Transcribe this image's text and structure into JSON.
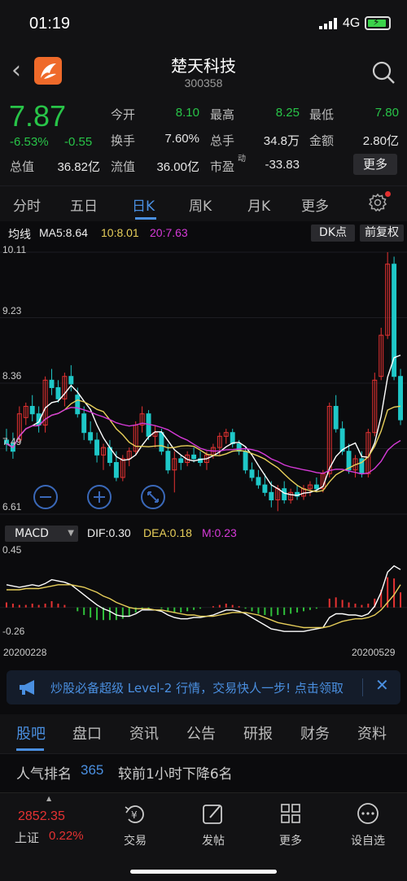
{
  "status_bar": {
    "time": "01:19",
    "network": "4G",
    "battery_level": 0.7
  },
  "header": {
    "title": "楚天科技",
    "code": "300358"
  },
  "quote": {
    "price": "7.87",
    "change_pct": "-6.53%",
    "change": "-0.55",
    "fields": [
      {
        "label": "今开",
        "value": "8.10",
        "color": "#28c448"
      },
      {
        "label": "最高",
        "value": "8.25",
        "color": "#28c448"
      },
      {
        "label": "最低",
        "value": "7.80",
        "color": "#28c448"
      },
      {
        "label": "换手",
        "value": "7.60%",
        "color": "#e6e6e6"
      },
      {
        "label": "总手",
        "value": "34.8万",
        "color": "#e6e6e6"
      },
      {
        "label": "金额",
        "value": "2.80亿",
        "color": "#e6e6e6"
      },
      {
        "label": "总值",
        "value": "36.82亿",
        "color": "#e6e6e6"
      },
      {
        "label": "流值",
        "value": "36.00亿",
        "color": "#e6e6e6"
      },
      {
        "label": "市盈",
        "label_sup": "动",
        "value": "-33.83",
        "color": "#e6e6e6"
      }
    ],
    "more_label": "更多"
  },
  "period_tabs": [
    "分时",
    "五日",
    "日K",
    "周K",
    "月K",
    "更多"
  ],
  "period_active": 2,
  "ma_bar": {
    "label": "均线",
    "ma5": "MA5:8.64",
    "ma10": "10:8.01",
    "ma20": "20:7.63",
    "dk_label": "DK点",
    "adjust_label": "前复权"
  },
  "kline": {
    "y_labels": [
      "10.11",
      "9.23",
      "8.36",
      "7.49",
      "6.61"
    ],
    "y_max": 10.11,
    "y_min": 6.61,
    "colors": {
      "up": "#e63232",
      "down": "#1fc8c8",
      "ma5": "#ffffff",
      "ma10": "#e8cf5a",
      "ma20": "#d63ad8"
    },
    "candles": [
      [
        7.6,
        7.75,
        7.45,
        7.55
      ],
      [
        7.55,
        7.7,
        7.35,
        7.45
      ],
      [
        7.6,
        8.05,
        7.55,
        7.95
      ],
      [
        7.9,
        8.1,
        7.8,
        8.05
      ],
      [
        8.05,
        8.2,
        7.85,
        7.95
      ],
      [
        7.95,
        8.05,
        7.7,
        7.8
      ],
      [
        7.8,
        8.45,
        7.7,
        8.4
      ],
      [
        8.4,
        8.55,
        8.2,
        8.3
      ],
      [
        8.3,
        8.4,
        8.1,
        8.15
      ],
      [
        8.15,
        8.5,
        8.05,
        8.45
      ],
      [
        8.45,
        8.6,
        8.25,
        8.35
      ],
      [
        8.2,
        8.3,
        7.9,
        7.95
      ],
      [
        7.95,
        8.05,
        7.6,
        7.7
      ],
      [
        7.7,
        7.85,
        7.55,
        7.6
      ],
      [
        7.6,
        7.7,
        7.3,
        7.4
      ],
      [
        7.4,
        7.55,
        7.2,
        7.5
      ],
      [
        7.5,
        7.6,
        7.25,
        7.3
      ],
      [
        7.3,
        7.45,
        7.05,
        7.1
      ],
      [
        7.1,
        7.4,
        7.05,
        7.35
      ],
      [
        7.35,
        7.5,
        7.25,
        7.45
      ],
      [
        7.45,
        7.85,
        7.4,
        7.8
      ],
      [
        7.8,
        8.05,
        7.7,
        7.95
      ],
      [
        7.95,
        8.0,
        7.6,
        7.65
      ],
      [
        7.65,
        7.8,
        7.5,
        7.7
      ],
      [
        7.7,
        7.75,
        7.4,
        7.45
      ],
      [
        7.45,
        7.55,
        7.15,
        7.2
      ],
      [
        7.2,
        7.45,
        6.9,
        7.35
      ],
      [
        7.35,
        7.4,
        7.2,
        7.3
      ],
      [
        7.3,
        7.45,
        7.25,
        7.4
      ],
      [
        7.4,
        7.5,
        7.3,
        7.35
      ],
      [
        7.35,
        7.45,
        7.25,
        7.3
      ],
      [
        7.3,
        7.45,
        7.2,
        7.4
      ],
      [
        7.4,
        7.55,
        7.35,
        7.5
      ],
      [
        7.5,
        7.7,
        7.4,
        7.65
      ],
      [
        7.65,
        7.75,
        7.55,
        7.7
      ],
      [
        7.7,
        7.75,
        7.5,
        7.55
      ],
      [
        7.55,
        7.6,
        7.4,
        7.45
      ],
      [
        7.45,
        7.5,
        7.15,
        7.2
      ],
      [
        7.2,
        7.3,
        7.05,
        7.1
      ],
      [
        7.1,
        7.2,
        6.95,
        7.0
      ],
      [
        7.0,
        7.15,
        6.85,
        6.9
      ],
      [
        6.9,
        7.05,
        6.7,
        6.8
      ],
      [
        6.8,
        7.0,
        6.65,
        6.95
      ],
      [
        6.95,
        7.05,
        6.75,
        6.8
      ],
      [
        6.8,
        6.95,
        6.75,
        6.9
      ],
      [
        6.9,
        7.0,
        6.8,
        6.85
      ],
      [
        6.85,
        7.0,
        6.8,
        6.95
      ],
      [
        6.95,
        7.05,
        6.85,
        7.0
      ],
      [
        7.0,
        7.1,
        6.9,
        6.95
      ],
      [
        6.95,
        7.2,
        6.9,
        7.15
      ],
      [
        7.15,
        8.1,
        7.1,
        8.05
      ],
      [
        8.05,
        8.2,
        7.7,
        7.75
      ],
      [
        7.75,
        7.85,
        7.4,
        7.45
      ],
      [
        7.45,
        7.55,
        7.15,
        7.2
      ],
      [
        7.2,
        7.4,
        7.1,
        7.35
      ],
      [
        7.35,
        7.45,
        7.1,
        7.15
      ],
      [
        7.15,
        7.75,
        7.1,
        7.7
      ],
      [
        7.7,
        8.5,
        7.65,
        8.4
      ],
      [
        8.45,
        9.1,
        8.4,
        9.0
      ],
      [
        9.0,
        10.11,
        8.95,
        9.95
      ],
      [
        9.95,
        10.05,
        8.4,
        8.45
      ],
      [
        8.45,
        8.55,
        7.8,
        7.87
      ]
    ]
  },
  "macd_bar": {
    "selector": "MACD",
    "dif": "DIF:0.30",
    "dea": "DEA:0.18",
    "m": "M:0.23"
  },
  "macd": {
    "y_labels": [
      "0.45",
      "-0.26"
    ],
    "y_max": 0.45,
    "y_min": -0.26,
    "dif": [
      0.18,
      0.17,
      0.16,
      0.17,
      0.18,
      0.17,
      0.19,
      0.22,
      0.21,
      0.2,
      0.18,
      0.14,
      0.1,
      0.06,
      0.02,
      -0.01,
      -0.03,
      -0.06,
      -0.07,
      -0.07,
      -0.05,
      -0.02,
      -0.02,
      -0.02,
      -0.03,
      -0.06,
      -0.08,
      -0.09,
      -0.09,
      -0.08,
      -0.08,
      -0.07,
      -0.06,
      -0.04,
      -0.02,
      -0.02,
      -0.03,
      -0.05,
      -0.08,
      -0.11,
      -0.14,
      -0.17,
      -0.18,
      -0.19,
      -0.19,
      -0.19,
      -0.19,
      -0.18,
      -0.17,
      -0.16,
      -0.08,
      -0.05,
      -0.05,
      -0.06,
      -0.06,
      -0.07,
      -0.05,
      0.01,
      0.12,
      0.28,
      0.33,
      0.3
    ],
    "dea": [
      0.14,
      0.14,
      0.14,
      0.15,
      0.15,
      0.15,
      0.16,
      0.17,
      0.18,
      0.18,
      0.18,
      0.17,
      0.16,
      0.14,
      0.12,
      0.09,
      0.07,
      0.04,
      0.02,
      0.0,
      -0.01,
      -0.01,
      -0.01,
      -0.02,
      -0.02,
      -0.03,
      -0.04,
      -0.05,
      -0.06,
      -0.06,
      -0.07,
      -0.07,
      -0.07,
      -0.06,
      -0.05,
      -0.04,
      -0.04,
      -0.04,
      -0.05,
      -0.06,
      -0.08,
      -0.1,
      -0.12,
      -0.13,
      -0.14,
      -0.15,
      -0.16,
      -0.16,
      -0.16,
      -0.16,
      -0.15,
      -0.13,
      -0.11,
      -0.1,
      -0.09,
      -0.09,
      -0.08,
      -0.06,
      -0.02,
      0.04,
      0.1,
      0.18
    ],
    "hist": [
      0.04,
      0.03,
      0.02,
      0.02,
      0.03,
      0.02,
      0.03,
      0.05,
      0.03,
      0.02,
      0.0,
      -0.03,
      -0.06,
      -0.08,
      -0.1,
      -0.1,
      -0.1,
      -0.1,
      -0.09,
      -0.07,
      -0.04,
      -0.01,
      -0.01,
      0.0,
      -0.01,
      -0.03,
      -0.04,
      -0.04,
      -0.03,
      -0.02,
      -0.01,
      0.0,
      0.01,
      0.02,
      0.03,
      0.02,
      0.01,
      -0.01,
      -0.03,
      -0.05,
      -0.06,
      -0.07,
      -0.06,
      -0.06,
      -0.05,
      -0.04,
      -0.03,
      -0.02,
      -0.01,
      0.0,
      0.07,
      0.08,
      0.06,
      0.04,
      0.03,
      0.02,
      0.03,
      0.07,
      0.14,
      0.24,
      0.23,
      0.12
    ],
    "dates": [
      "20200228",
      "20200529"
    ]
  },
  "banner": {
    "text": "炒股必备超级 Level-2 行情，交易快人一步! 点击领取"
  },
  "sub_tabs": [
    "股吧",
    "盘口",
    "资讯",
    "公告",
    "研报",
    "财务",
    "资料"
  ],
  "sub_active": 0,
  "rank": {
    "label": "人气排名",
    "value": "365",
    "tail": "较前1小时下降6名"
  },
  "bottom_nav": {
    "index_value": "2852.35",
    "index_name": "上证",
    "index_pct": "0.22%",
    "items": [
      "交易",
      "发帖",
      "更多",
      "设自选"
    ]
  }
}
